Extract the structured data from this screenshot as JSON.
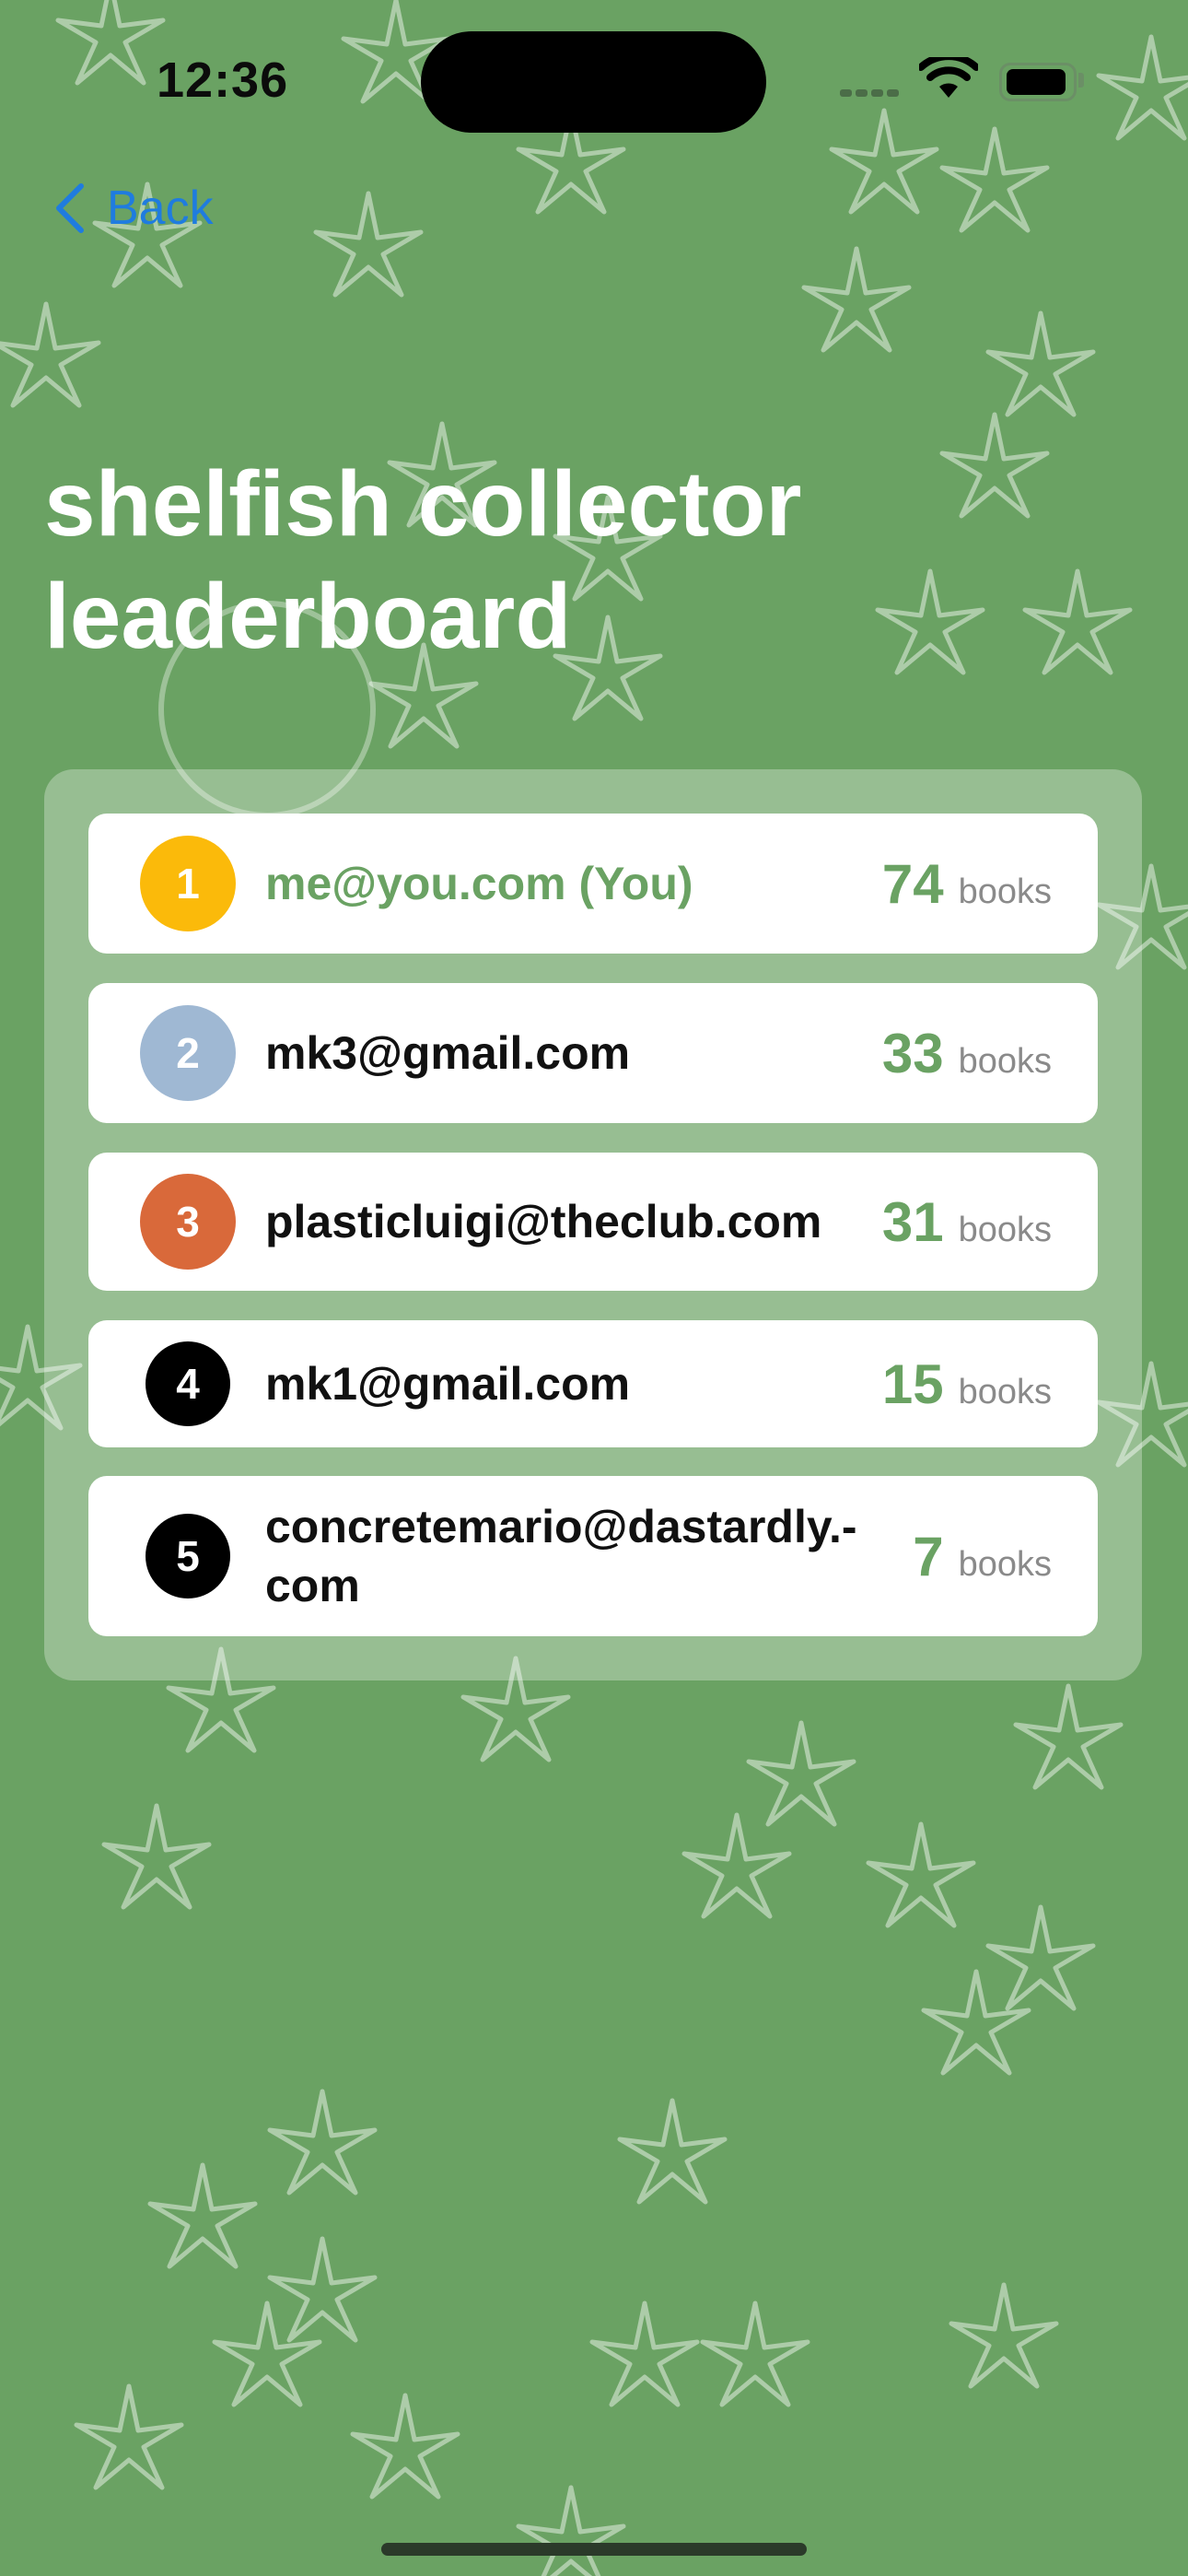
{
  "status_bar": {
    "time": "12:36"
  },
  "nav": {
    "back_label": "Back"
  },
  "title": "shelfish collector leaderboard",
  "colors": {
    "background": "#6aa263",
    "accent": "#1f7cdf",
    "rank_1": "#fbba0a",
    "rank_2": "#9fb8d3",
    "rank_3": "#d9693a",
    "rank_other": "#000000"
  },
  "leaderboard": [
    {
      "rank": "1",
      "email": "me@you.com (You)",
      "score": "74",
      "unit": "books"
    },
    {
      "rank": "2",
      "email": "mk3@gmail.com",
      "score": "33",
      "unit": "books"
    },
    {
      "rank": "3",
      "email": "plasticluigi@theclub.com",
      "score": "31",
      "unit": "books"
    },
    {
      "rank": "4",
      "email": "mk1@gmail.com",
      "score": "15",
      "unit": "books"
    },
    {
      "rank": "5",
      "email": "concretemario@dastardly.-com",
      "score": "7",
      "unit": "books"
    }
  ]
}
